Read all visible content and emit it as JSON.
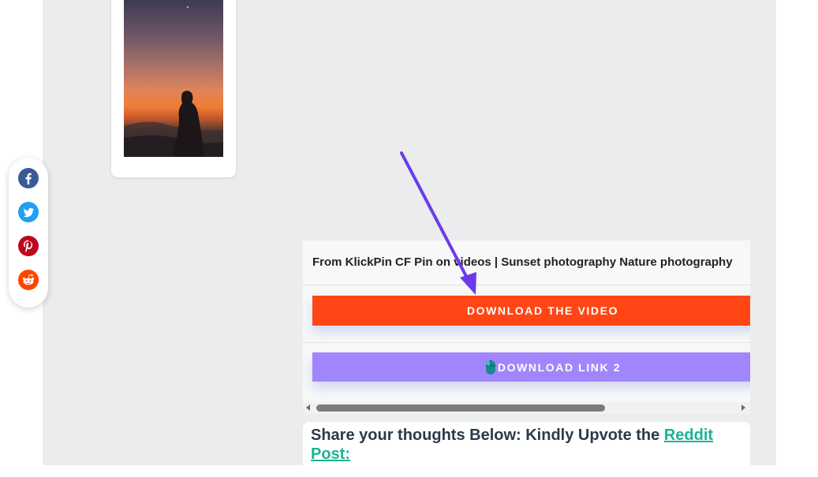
{
  "share": {
    "items": [
      {
        "name": "facebook",
        "color": "#3b5998",
        "icon": "facebook-icon"
      },
      {
        "name": "twitter",
        "color": "#1da1f2",
        "icon": "twitter-icon"
      },
      {
        "name": "pinterest",
        "color": "#bd081c",
        "icon": "pinterest-icon"
      },
      {
        "name": "reddit",
        "color": "#ff4500",
        "icon": "reddit-icon"
      }
    ]
  },
  "download": {
    "title": "From KlickPin CF Pin on videos | Sunset photography Nature photography",
    "video_label": "DOWNLOAD THE VIDEO",
    "link2_label": "DOWNLOAD LINK 2",
    "video_color": "#ff4614",
    "link2_color": "#a085fd"
  },
  "comment": {
    "prefix": "Share your thoughts Below: Kindly Upvote the ",
    "link_text": "Reddit Post:"
  },
  "annotation": {
    "arrow_color": "#6a3ce8"
  }
}
